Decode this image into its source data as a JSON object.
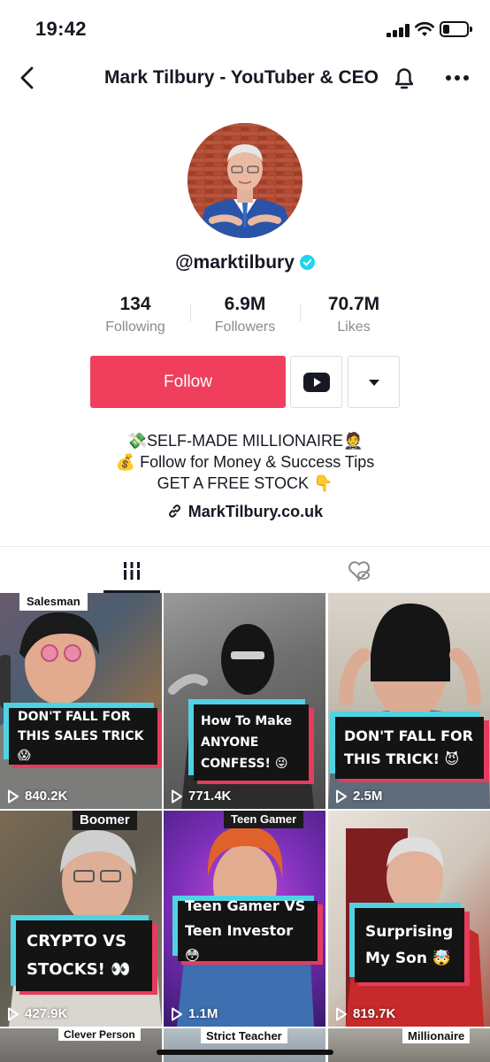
{
  "status_bar": {
    "time": "19:42"
  },
  "nav": {
    "title": "Mark Tilbury - YouTuber & CEO",
    "back_icon": "chevron-left-icon",
    "bell_icon": "bell-icon",
    "more_icon": "ellipsis-icon"
  },
  "profile": {
    "username": "@marktilbury",
    "verified": true,
    "stats": [
      {
        "value": "134",
        "label": "Following"
      },
      {
        "value": "6.9M",
        "label": "Followers"
      },
      {
        "value": "70.7M",
        "label": "Likes"
      }
    ],
    "follow_label": "Follow",
    "bio_lines": [
      "💸SELF-MADE MILLIONAIRE🤵",
      "💰 Follow for Money & Success Tips",
      "GET A FREE STOCK 👇"
    ],
    "link": "MarkTilbury.co.uk"
  },
  "colors": {
    "accent": "#ef3f5c",
    "caption_cyan": "#4fd3e3",
    "caption_red": "#e53c5d"
  },
  "videos": [
    {
      "tag": "Salesman",
      "caption_lines": [
        "DON'T FALL FOR",
        "THIS SALES TRICK😱"
      ],
      "plays": "840.2K"
    },
    {
      "tag": "",
      "caption_lines": [
        "How To Make",
        "ANYONE",
        "CONFESS! 😜"
      ],
      "plays": "771.4K"
    },
    {
      "tag": "",
      "caption_lines": [
        "DON'T FALL FOR",
        "THIS TRICK! 😈"
      ],
      "plays": "2.5M"
    },
    {
      "tag": "Boomer",
      "caption_lines": [
        "CRYPTO VS",
        "STOCKS! 👀"
      ],
      "plays": "427.9K"
    },
    {
      "tag": "Teen Gamer",
      "caption_lines": [
        "Teen Gamer VS",
        "Teen Investor 😳"
      ],
      "plays": "1.1M"
    },
    {
      "tag": "",
      "caption_lines": [
        "Surprising",
        "My Son 🤯"
      ],
      "plays": "819.7K"
    }
  ],
  "partial_row_tags": [
    "Clever Person",
    "Strict Teacher",
    "Millionaire"
  ]
}
